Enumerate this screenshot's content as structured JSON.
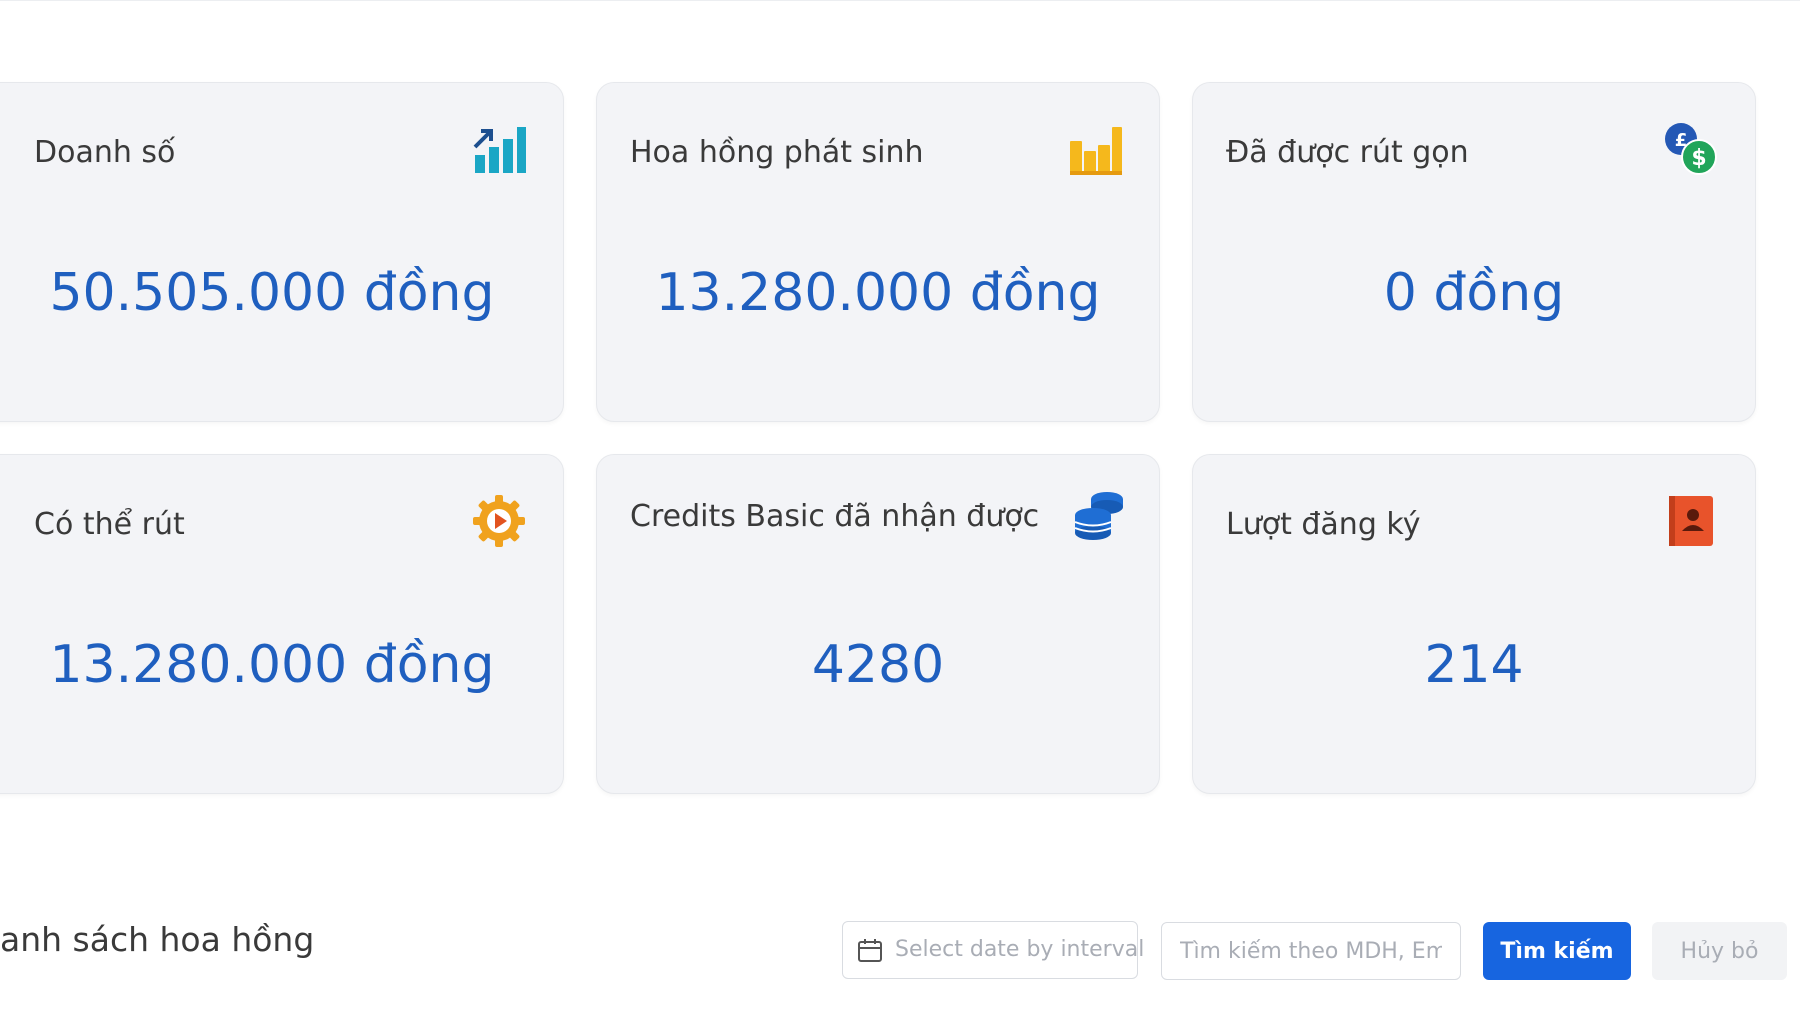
{
  "stats": [
    {
      "title": "Doanh số",
      "value": "50.505.000 đồng",
      "icon": "bar-chart-up-icon",
      "color": "#1aa6c5"
    },
    {
      "title": "Hoa hồng phát sinh",
      "value": "13.280.000 đồng",
      "icon": "bar-chart-icon",
      "color": "#f5b81c"
    },
    {
      "title": "Đã được rút gọn",
      "value": "0 đồng",
      "icon": "currency-exchange-icon",
      "color": "#1d9e50"
    },
    {
      "title": "Có thể rút",
      "value": "13.280.000 đồng",
      "icon": "gear-play-icon",
      "color": "#f0a21e"
    },
    {
      "title": "Credits Basic đã nhận được",
      "value": "4280",
      "icon": "coin-stack-icon",
      "color": "#1f6ed4"
    },
    {
      "title": "Lượt đăng ký",
      "value": "214",
      "icon": "contact-book-icon",
      "color": "#e8532b"
    }
  ],
  "list": {
    "title": "anh sách hoa hồng"
  },
  "filters": {
    "date_placeholder": "Select date by interval",
    "search_placeholder": "Tìm kiếm theo MDH, Ema",
    "search_button": "Tìm kiếm",
    "cancel_button": "Hủy bỏ"
  },
  "colors": {
    "value_text": "#1f5fbf",
    "primary_button": "#1765e0",
    "card_background": "#f3f4f7"
  }
}
